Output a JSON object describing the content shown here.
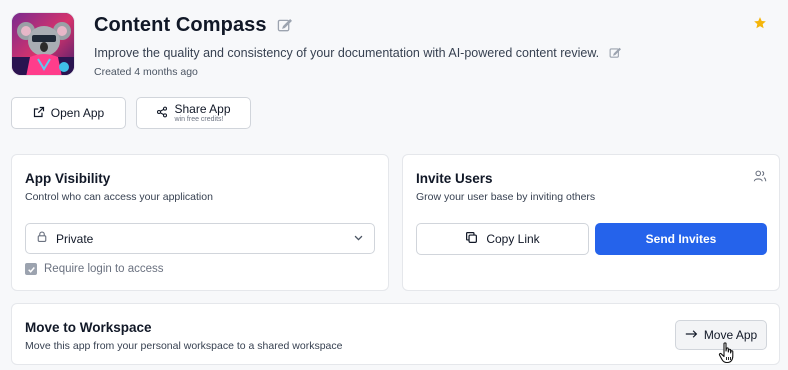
{
  "app": {
    "title": "Content Compass",
    "description": "Improve the quality and consistency of your documentation with AI-powered content review.",
    "created": "Created 4 months ago",
    "favorite_color": "#f5b50a"
  },
  "actions": {
    "open_label": "Open App",
    "share_label": "Share App",
    "share_sublabel": "win free credits!"
  },
  "visibility": {
    "title": "App Visibility",
    "subtitle": "Control who can access your application",
    "selected": "Private",
    "require_login_label": "Require login to access",
    "require_login_checked": true
  },
  "invite": {
    "title": "Invite Users",
    "subtitle": "Grow your user base by inviting others",
    "copy_label": "Copy Link",
    "send_label": "Send Invites",
    "accent_color": "#2563eb"
  },
  "move": {
    "title": "Move to Workspace",
    "subtitle": "Move this app from your personal workspace to a shared workspace",
    "button_label": "Move App"
  },
  "icons": [
    "edit-icon",
    "star-icon",
    "external-link-icon",
    "share-icon",
    "lock-icon",
    "chevron-down-icon",
    "check-icon",
    "users-icon",
    "copy-icon",
    "arrow-right-icon",
    "hand-cursor-icon"
  ]
}
